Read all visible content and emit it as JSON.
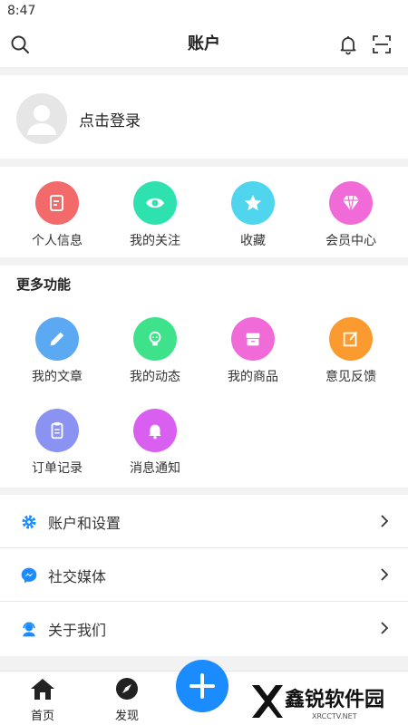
{
  "status": {
    "time": "8:47"
  },
  "header": {
    "title": "账户"
  },
  "login": {
    "label": "点击登录"
  },
  "quick": [
    {
      "label": "个人信息",
      "color": "#f36a6a",
      "icon": "edit-note-icon"
    },
    {
      "label": "我的关注",
      "color": "#2ee2b0",
      "icon": "eye-icon"
    },
    {
      "label": "收藏",
      "color": "#4fd6ee",
      "icon": "star-icon"
    },
    {
      "label": "会员中心",
      "color": "#f06ad8",
      "icon": "diamond-icon"
    }
  ],
  "more": {
    "title": "更多功能",
    "items": [
      {
        "label": "我的文章",
        "color": "#5aa9f2",
        "icon": "pencil-icon"
      },
      {
        "label": "我的动态",
        "color": "#3ee28a",
        "icon": "bulb-icon"
      },
      {
        "label": "我的商品",
        "color": "#f06ad8",
        "icon": "box-icon"
      },
      {
        "label": "意见反馈",
        "color": "#fb9a2e",
        "icon": "feedback-icon"
      },
      {
        "label": "订单记录",
        "color": "#8a92f2",
        "icon": "clipboard-icon"
      },
      {
        "label": "消息通知",
        "color": "#d95ff0",
        "icon": "bell-icon"
      }
    ]
  },
  "list": [
    {
      "label": "账户和设置",
      "icon": "gear-icon"
    },
    {
      "label": "社交媒体",
      "icon": "messenger-icon"
    },
    {
      "label": "关于我们",
      "icon": "support-agent-icon"
    }
  ],
  "tabs": [
    {
      "label": "首页",
      "icon": "home-icon"
    },
    {
      "label": "发现",
      "icon": "compass-icon"
    }
  ],
  "watermark": {
    "text": "鑫锐软件园",
    "sub": "XRCCTV.NET"
  },
  "colors": {
    "accent": "#1a8cff",
    "background": "#f2f2f2"
  }
}
